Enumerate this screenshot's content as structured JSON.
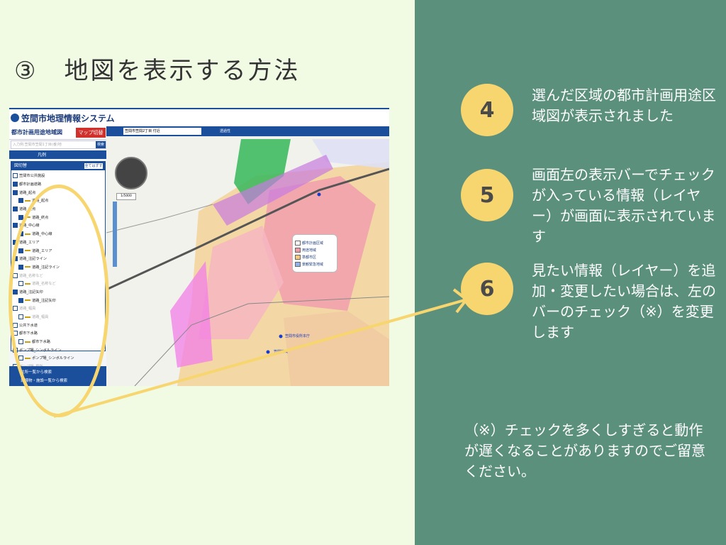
{
  "slide": {
    "title": "③　地図を表示する方法"
  },
  "steps": [
    {
      "number": "4",
      "text": "選んだ区域の都市計画用途区域図が表示されました"
    },
    {
      "number": "5",
      "text": "画面左の表示バーでチェックが入っている情報（レイヤー）が画面に表示されています"
    },
    {
      "number": "6",
      "text": "見たい情報（レイヤー）を追加・変更したい場合は、左のバーのチェック（※）を変更します"
    }
  ],
  "note": "（※）チェックを多くしすぎると動作が遅くなることがありますのでご留意ください。",
  "screenshot": {
    "app_title": "笠間市地理情報システム",
    "panel_title": "都市計画用途地域図",
    "map_switch": "マップ切替",
    "search_placeholder": "入力例:笠間市笠間1丁目(番)地",
    "search_button": "検索",
    "tab_label": "凡例",
    "layer_header": "図切替",
    "layer_all_button": "全てはずす",
    "layers": [
      {
        "label": "笠間市公共施設",
        "checked": false,
        "indent": false,
        "dim": false
      },
      {
        "label": "都市計画道路",
        "checked": true,
        "indent": false,
        "dim": false
      },
      {
        "label": "道路_起点",
        "checked": true,
        "indent": false,
        "dim": false
      },
      {
        "label": "道路_起点",
        "checked": true,
        "indent": true,
        "dim": false
      },
      {
        "label": "道路_終点",
        "checked": true,
        "indent": false,
        "dim": false
      },
      {
        "label": "道路_終点",
        "checked": true,
        "indent": true,
        "dim": false
      },
      {
        "label": "道路_中心線",
        "checked": true,
        "indent": false,
        "dim": false
      },
      {
        "label": "道路_中心線",
        "checked": true,
        "indent": true,
        "dim": false
      },
      {
        "label": "道路_エリア",
        "checked": true,
        "indent": false,
        "dim": false
      },
      {
        "label": "道路_エリア",
        "checked": true,
        "indent": true,
        "dim": false
      },
      {
        "label": "道路_注記ライン",
        "checked": true,
        "indent": false,
        "dim": false
      },
      {
        "label": "道路_注記ライン",
        "checked": true,
        "indent": true,
        "dim": false
      },
      {
        "label": "道路_名称など",
        "checked": false,
        "indent": false,
        "dim": true
      },
      {
        "label": "道路_名称など",
        "checked": false,
        "indent": true,
        "dim": true
      },
      {
        "label": "道路_注記矢印",
        "checked": true,
        "indent": false,
        "dim": false
      },
      {
        "label": "道路_注記矢印",
        "checked": true,
        "indent": true,
        "dim": false
      },
      {
        "label": "道路_幅員",
        "checked": false,
        "indent": false,
        "dim": true
      },
      {
        "label": "道路_幅員",
        "checked": false,
        "indent": true,
        "dim": true
      },
      {
        "label": "公共下水道",
        "checked": false,
        "indent": false,
        "dim": false
      },
      {
        "label": "都市下水路",
        "checked": false,
        "indent": false,
        "dim": false
      },
      {
        "label": "都市下水路",
        "checked": false,
        "indent": true,
        "dim": false
      },
      {
        "label": "ポンプ場_シンボルライン",
        "checked": false,
        "indent": false,
        "dim": false
      },
      {
        "label": "ポンプ場_シンボルライン",
        "checked": false,
        "indent": true,
        "dim": false
      },
      {
        "label": "ポンプ場_局所",
        "checked": false,
        "indent": false,
        "dim": true
      }
    ],
    "footer_links": [
      "住所一覧から検索",
      "目標物・施設一覧から検索"
    ],
    "map_address": "笠間市笠間2丁目 付近",
    "map_opacity_label": "透過性",
    "map_scale": "1/5000",
    "legend_items": [
      {
        "label": "都市計画区域",
        "color": "#ffffff"
      },
      {
        "label": "用途地域",
        "color": "#f29aa6"
      },
      {
        "label": "準都市区",
        "color": "#f5c87a"
      },
      {
        "label": "景観緊急地域",
        "color": "#8fb2e8"
      }
    ],
    "map_labels": [
      "笠間市役所本庁",
      "笠間地域"
    ]
  },
  "colors": {
    "left_bg": "#f1fbe4",
    "right_bg": "#5b907c",
    "accent_yellow": "#f7d56f",
    "app_blue": "#1b4f9c"
  }
}
